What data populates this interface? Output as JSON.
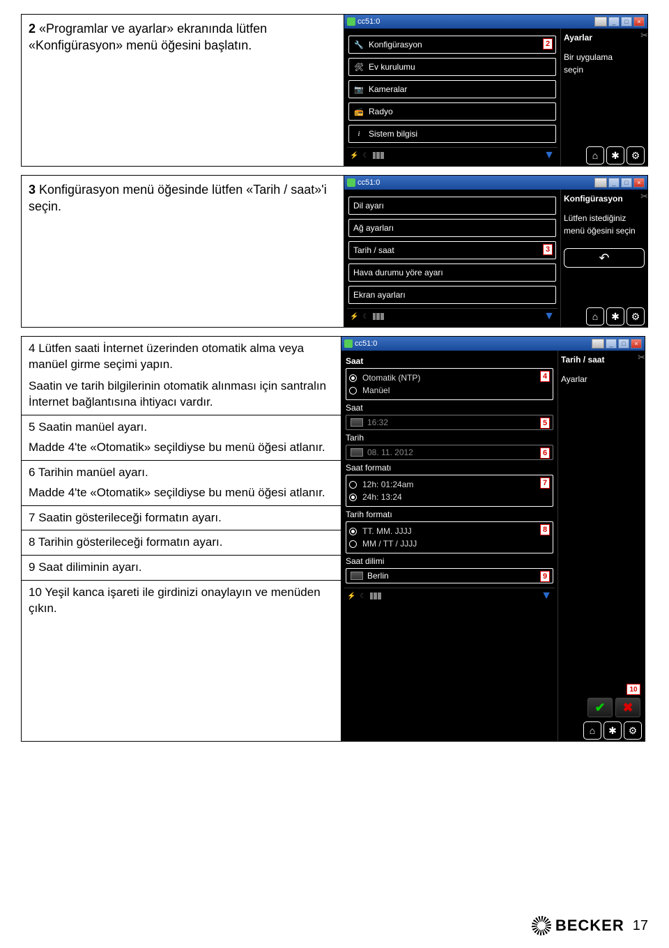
{
  "steps": {
    "s2": "«Programlar ve ayarlar» ekranında lütfen «Konfigürasyon» menü öğesini başlatın.",
    "s3": "Konfigürasyon menü öğesinde lütfen «Tarih / saat»'i seçin.",
    "s4a": "Lütfen saati İnternet üzerinden otomatik alma veya manüel girme seçimi yapın.",
    "s4b": "Saatin ve tarih bilgilerinin otomatik alınması için santralın İnternet bağlantısına ihtiyacı vardır.",
    "s5a": "Saatin manüel ayarı.",
    "s5b": "Madde 4'te «Otomatik» seçildiyse bu menü öğesi atlanır.",
    "s6a": "Tarihin manüel ayarı.",
    "s6b": "Madde 4'te «Otomatik» seçildiyse bu menü öğesi atlanır.",
    "s7": "Saatin gösterileceği formatın ayarı.",
    "s8": "Tarihin gösterileceği formatın ayarı.",
    "s9": "Saat diliminin ayarı.",
    "s10": "Yeşil kanca işareti ile girdinizi onaylayın ve menüden çıkın."
  },
  "screen1": {
    "title": "cc51:0",
    "menu": {
      "konfig": "Konfigürasyon",
      "ev": "Ev kurulumu",
      "kamera": "Kameralar",
      "radyo": "Radyo",
      "sistem": "Sistem bilgisi"
    },
    "side": {
      "title": "Ayarlar",
      "sub1": "Bir uygulama",
      "sub2": "seçin"
    },
    "badge": "2"
  },
  "screen2": {
    "title": "cc51:0",
    "menu": {
      "dil": "Dil ayarı",
      "ag": "Ağ ayarları",
      "tarih": "Tarih / saat",
      "hava": "Hava durumu yöre ayarı",
      "ekran": "Ekran ayarları"
    },
    "side": {
      "title": "Konfigürasyon",
      "sub1": "Lütfen istediğiniz",
      "sub2": "menü öğesini seçin"
    },
    "badge": "3"
  },
  "screen3": {
    "title": "cc51:0",
    "header": "Saat",
    "mode": {
      "auto": "Otomatik (NTP)",
      "manual": "Manüel"
    },
    "sections": {
      "saat": "Saat",
      "tarih": "Tarih",
      "saatfmt": "Saat formatı",
      "tarihfmt": "Tarih formatı",
      "dilim": "Saat dilimi"
    },
    "values": {
      "time": "16:32",
      "date": "08. 11. 2012",
      "tf12": "12h: 01:24am",
      "tf24": "24h: 13:24",
      "df1": "TT. MM. JJJJ",
      "df2": "MM / TT / JJJJ",
      "tz": "Berlin"
    },
    "badges": {
      "b4": "4",
      "b5": "5",
      "b6": "6",
      "b7": "7",
      "b8": "8",
      "b9": "9",
      "b10": "10"
    },
    "side": {
      "title": "Tarih / saat",
      "sub": "Ayarlar"
    }
  },
  "footer": {
    "brand": "BECKER",
    "page": "17"
  }
}
